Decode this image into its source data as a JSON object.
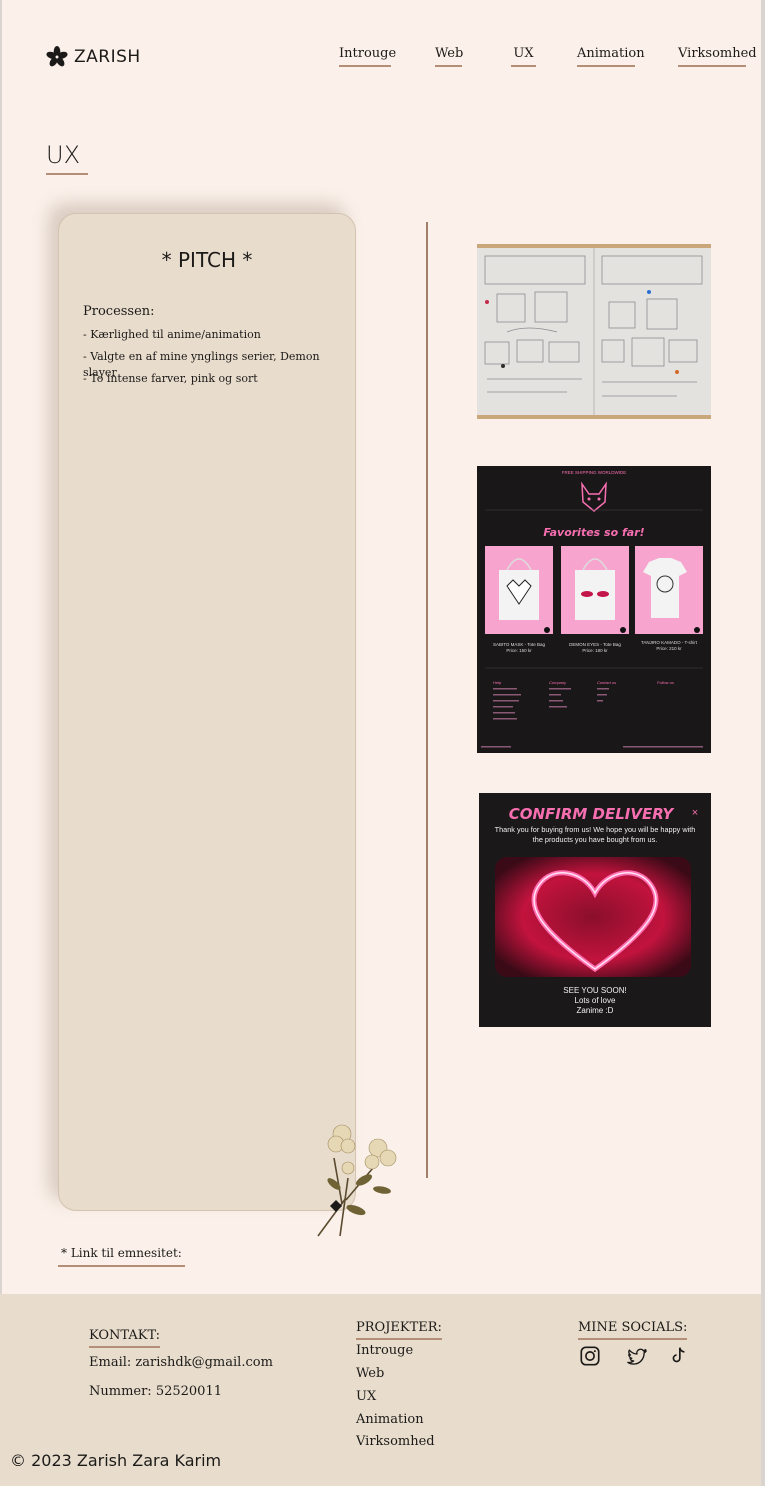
{
  "header": {
    "logo_text": "ZARISH",
    "nav": [
      "Introuge",
      "Web",
      "UX",
      "Animation",
      "Virksomhed"
    ]
  },
  "page_title": "UX",
  "pitch": {
    "title": "* PITCH *",
    "subtitle": "Processen:",
    "items": [
      "- Kærlighed til anime/animation",
      "- Valgte en af mine ynglings serier, Demon slayer",
      "- To intense farver, pink og sort"
    ]
  },
  "shop_mockup": {
    "banner": "FREE SHIPPING WORLDWIDE",
    "heading": "Favorites so far!",
    "products": [
      {
        "name": "SABITO MASK - Tote Bag",
        "price": "Price: 150 kr"
      },
      {
        "name": "DEMON EYES - Tote Bag",
        "price": "Price: 180 kr"
      },
      {
        "name": "TANJIRO KAMADO - T-shirt",
        "price": "Price: 210 kr"
      }
    ],
    "footer_cols": [
      "Help",
      "Company",
      "Contact us",
      "Follow us"
    ]
  },
  "confirm_mockup": {
    "title": "CONFIRM DELIVERY",
    "body": "Thank you for buying from us! We hope you will be happy with the products you have bought from us.",
    "line1": "SEE YOU SOON!",
    "line2": "Lots of love",
    "line3": "Zanime :D"
  },
  "link_label": "* Link til emnesitet:",
  "footer": {
    "contact_heading": "KONTAKT:",
    "email": "Email: zarishdk@gmail.com",
    "phone": "Nummer: 52520011",
    "projects_heading": "PROJEKTER:",
    "projects": [
      "Introuge",
      "Web",
      "UX",
      "Animation",
      "Virksomhed"
    ],
    "socials_heading": "MINE SOCIALS:",
    "socials": [
      "instagram-icon",
      "twitter-icon",
      "tiktok-icon"
    ]
  },
  "copyright": "© 2023 Zarish Zara Karim",
  "colors": {
    "background": "#fbf1ea",
    "card": "#e8dccd",
    "accent": "#b48f78",
    "pink": "#f76fb0"
  }
}
